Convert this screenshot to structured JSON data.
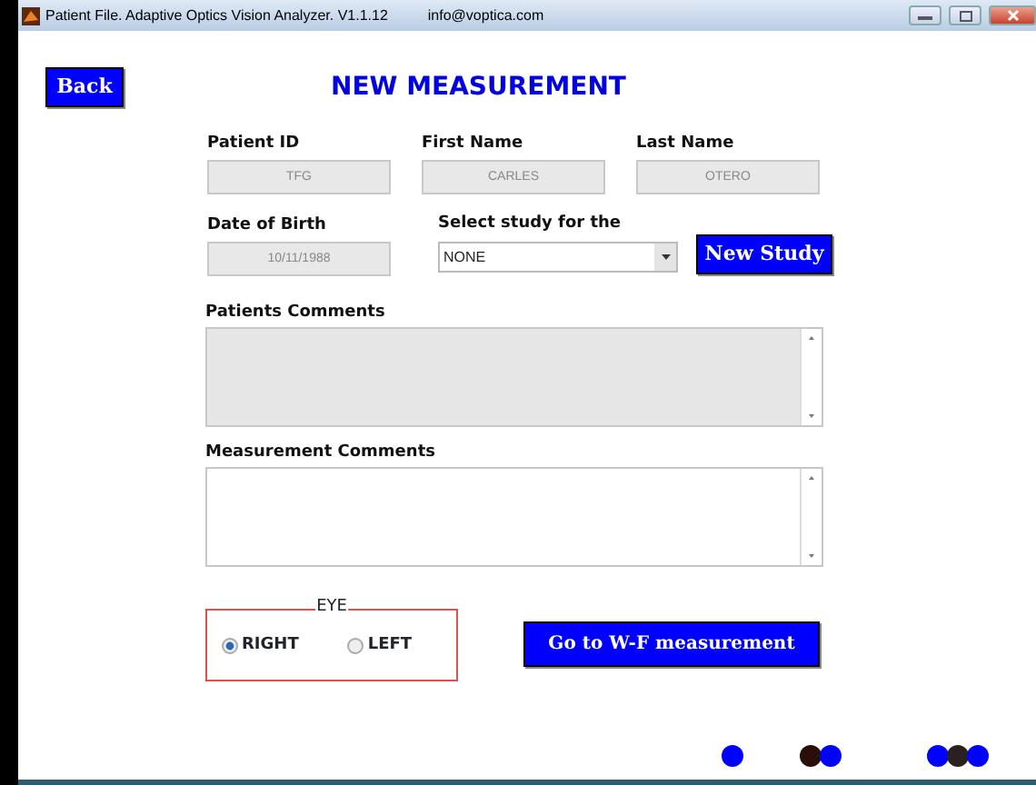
{
  "window": {
    "title": "Patient File. Adaptive Optics Vision Analyzer. V1.1.12",
    "email": "info@voptica.com"
  },
  "back_button": "Back",
  "heading": "NEW MEASUREMENT",
  "patient_fields": [
    {
      "label": "Patient ID",
      "value": "TFG"
    },
    {
      "label": "First Name",
      "value": "CARLES"
    },
    {
      "label": "Last Name",
      "value": "OTERO"
    }
  ],
  "birth": {
    "label": "Date of Birth",
    "value": "10/11/1988"
  },
  "study": {
    "label": "Select study for the",
    "value": "NONE"
  },
  "new_study_button": "New Study",
  "patients_comments": {
    "label": "Patients Comments",
    "disabled": true
  },
  "measurement_comments": {
    "label": "Measurement Comments",
    "disabled": false
  },
  "eye": {
    "legend": "EYE",
    "options": [
      {
        "label": "RIGHT",
        "selected": true
      },
      {
        "label": "LEFT",
        "selected": false
      }
    ]
  },
  "go_button": "Go to W-F measurement",
  "step_dots": [
    {
      "dots": [
        {
          "color": "#0000ff"
        }
      ]
    },
    {
      "dots": [
        {
          "color": "#2a0e08"
        },
        {
          "color": "#0000ff"
        }
      ]
    },
    {
      "dots": [
        {
          "color": "#0000ff"
        },
        {
          "color": "#2a2020"
        },
        {
          "color": "#0000ff"
        }
      ]
    }
  ]
}
